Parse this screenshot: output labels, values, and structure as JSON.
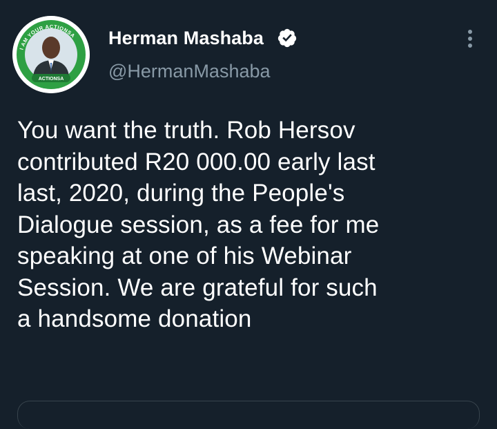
{
  "author": {
    "name": "Herman Mashaba",
    "handle": "@HermanMashaba",
    "verified": true,
    "avatar": {
      "ring_text_top": "I AM YOUR ACTIONSA",
      "badge_text": "ACTIONSA",
      "ring_color": "#2ea043"
    }
  },
  "tweet": {
    "lines": [
      "You want the truth. Rob Hersov",
      "contributed R20 000.00 early last",
      "last, 2020, during the People's",
      "Dialogue session, as a fee for me",
      "speaking at one of his Webinar",
      "Session. We are grateful for such",
      "a handsome donation"
    ]
  },
  "colors": {
    "background": "#15202b",
    "text": "#ffffff",
    "secondary": "#8899a6",
    "border": "#38444d"
  },
  "icons": {
    "verified": "verified-badge-icon",
    "more": "more-vertical-icon"
  }
}
